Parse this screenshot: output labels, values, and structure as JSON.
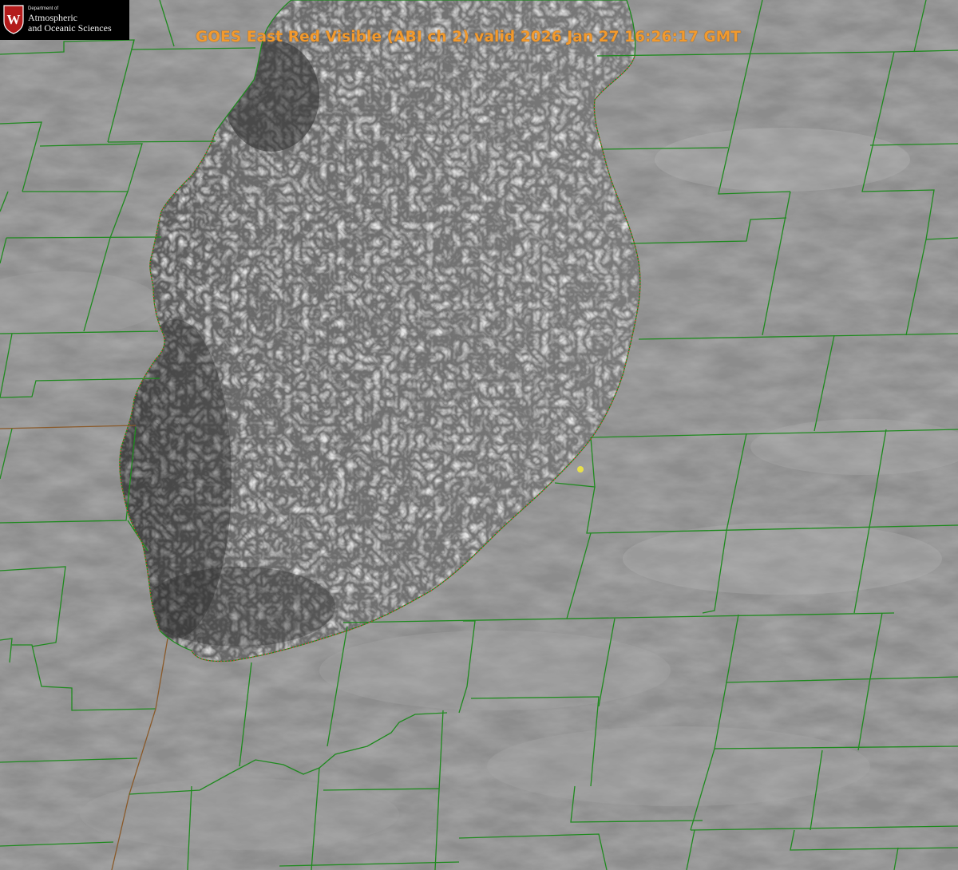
{
  "title": "GOES East Red Visible (ABI ch 2) valid 2026 Jan 27 16:26:17 GMT",
  "logo": {
    "small": "Department of",
    "line1": "Atmospheric",
    "line2": "and Oceanic Sciences",
    "seal_letter": "W"
  },
  "colors": {
    "county_lines": "#1f8a1f",
    "shoreline_dots": "#e03a3a",
    "station_dot": "#e8e04a",
    "title": "#f29a2e",
    "seal": "#b31b1b"
  },
  "icons": {
    "seal": "university-crest-icon",
    "station": "location-dot-icon"
  }
}
